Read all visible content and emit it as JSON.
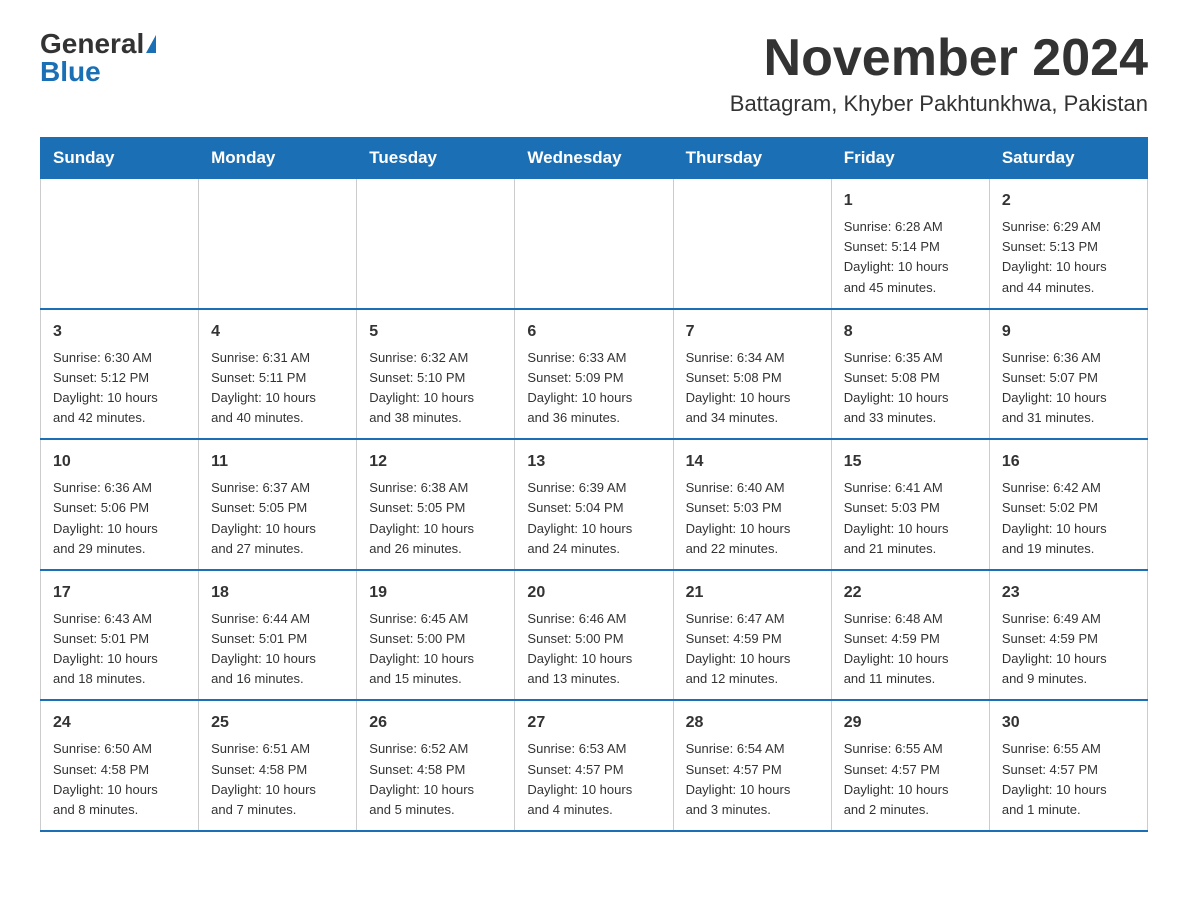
{
  "header": {
    "logo_general": "General",
    "logo_blue": "Blue",
    "month_title": "November 2024",
    "location": "Battagram, Khyber Pakhtunkhwa, Pakistan"
  },
  "weekdays": [
    "Sunday",
    "Monday",
    "Tuesday",
    "Wednesday",
    "Thursday",
    "Friday",
    "Saturday"
  ],
  "weeks": [
    [
      {
        "day": "",
        "info": ""
      },
      {
        "day": "",
        "info": ""
      },
      {
        "day": "",
        "info": ""
      },
      {
        "day": "",
        "info": ""
      },
      {
        "day": "",
        "info": ""
      },
      {
        "day": "1",
        "info": "Sunrise: 6:28 AM\nSunset: 5:14 PM\nDaylight: 10 hours\nand 45 minutes."
      },
      {
        "day": "2",
        "info": "Sunrise: 6:29 AM\nSunset: 5:13 PM\nDaylight: 10 hours\nand 44 minutes."
      }
    ],
    [
      {
        "day": "3",
        "info": "Sunrise: 6:30 AM\nSunset: 5:12 PM\nDaylight: 10 hours\nand 42 minutes."
      },
      {
        "day": "4",
        "info": "Sunrise: 6:31 AM\nSunset: 5:11 PM\nDaylight: 10 hours\nand 40 minutes."
      },
      {
        "day": "5",
        "info": "Sunrise: 6:32 AM\nSunset: 5:10 PM\nDaylight: 10 hours\nand 38 minutes."
      },
      {
        "day": "6",
        "info": "Sunrise: 6:33 AM\nSunset: 5:09 PM\nDaylight: 10 hours\nand 36 minutes."
      },
      {
        "day": "7",
        "info": "Sunrise: 6:34 AM\nSunset: 5:08 PM\nDaylight: 10 hours\nand 34 minutes."
      },
      {
        "day": "8",
        "info": "Sunrise: 6:35 AM\nSunset: 5:08 PM\nDaylight: 10 hours\nand 33 minutes."
      },
      {
        "day": "9",
        "info": "Sunrise: 6:36 AM\nSunset: 5:07 PM\nDaylight: 10 hours\nand 31 minutes."
      }
    ],
    [
      {
        "day": "10",
        "info": "Sunrise: 6:36 AM\nSunset: 5:06 PM\nDaylight: 10 hours\nand 29 minutes."
      },
      {
        "day": "11",
        "info": "Sunrise: 6:37 AM\nSunset: 5:05 PM\nDaylight: 10 hours\nand 27 minutes."
      },
      {
        "day": "12",
        "info": "Sunrise: 6:38 AM\nSunset: 5:05 PM\nDaylight: 10 hours\nand 26 minutes."
      },
      {
        "day": "13",
        "info": "Sunrise: 6:39 AM\nSunset: 5:04 PM\nDaylight: 10 hours\nand 24 minutes."
      },
      {
        "day": "14",
        "info": "Sunrise: 6:40 AM\nSunset: 5:03 PM\nDaylight: 10 hours\nand 22 minutes."
      },
      {
        "day": "15",
        "info": "Sunrise: 6:41 AM\nSunset: 5:03 PM\nDaylight: 10 hours\nand 21 minutes."
      },
      {
        "day": "16",
        "info": "Sunrise: 6:42 AM\nSunset: 5:02 PM\nDaylight: 10 hours\nand 19 minutes."
      }
    ],
    [
      {
        "day": "17",
        "info": "Sunrise: 6:43 AM\nSunset: 5:01 PM\nDaylight: 10 hours\nand 18 minutes."
      },
      {
        "day": "18",
        "info": "Sunrise: 6:44 AM\nSunset: 5:01 PM\nDaylight: 10 hours\nand 16 minutes."
      },
      {
        "day": "19",
        "info": "Sunrise: 6:45 AM\nSunset: 5:00 PM\nDaylight: 10 hours\nand 15 minutes."
      },
      {
        "day": "20",
        "info": "Sunrise: 6:46 AM\nSunset: 5:00 PM\nDaylight: 10 hours\nand 13 minutes."
      },
      {
        "day": "21",
        "info": "Sunrise: 6:47 AM\nSunset: 4:59 PM\nDaylight: 10 hours\nand 12 minutes."
      },
      {
        "day": "22",
        "info": "Sunrise: 6:48 AM\nSunset: 4:59 PM\nDaylight: 10 hours\nand 11 minutes."
      },
      {
        "day": "23",
        "info": "Sunrise: 6:49 AM\nSunset: 4:59 PM\nDaylight: 10 hours\nand 9 minutes."
      }
    ],
    [
      {
        "day": "24",
        "info": "Sunrise: 6:50 AM\nSunset: 4:58 PM\nDaylight: 10 hours\nand 8 minutes."
      },
      {
        "day": "25",
        "info": "Sunrise: 6:51 AM\nSunset: 4:58 PM\nDaylight: 10 hours\nand 7 minutes."
      },
      {
        "day": "26",
        "info": "Sunrise: 6:52 AM\nSunset: 4:58 PM\nDaylight: 10 hours\nand 5 minutes."
      },
      {
        "day": "27",
        "info": "Sunrise: 6:53 AM\nSunset: 4:57 PM\nDaylight: 10 hours\nand 4 minutes."
      },
      {
        "day": "28",
        "info": "Sunrise: 6:54 AM\nSunset: 4:57 PM\nDaylight: 10 hours\nand 3 minutes."
      },
      {
        "day": "29",
        "info": "Sunrise: 6:55 AM\nSunset: 4:57 PM\nDaylight: 10 hours\nand 2 minutes."
      },
      {
        "day": "30",
        "info": "Sunrise: 6:55 AM\nSunset: 4:57 PM\nDaylight: 10 hours\nand 1 minute."
      }
    ]
  ]
}
